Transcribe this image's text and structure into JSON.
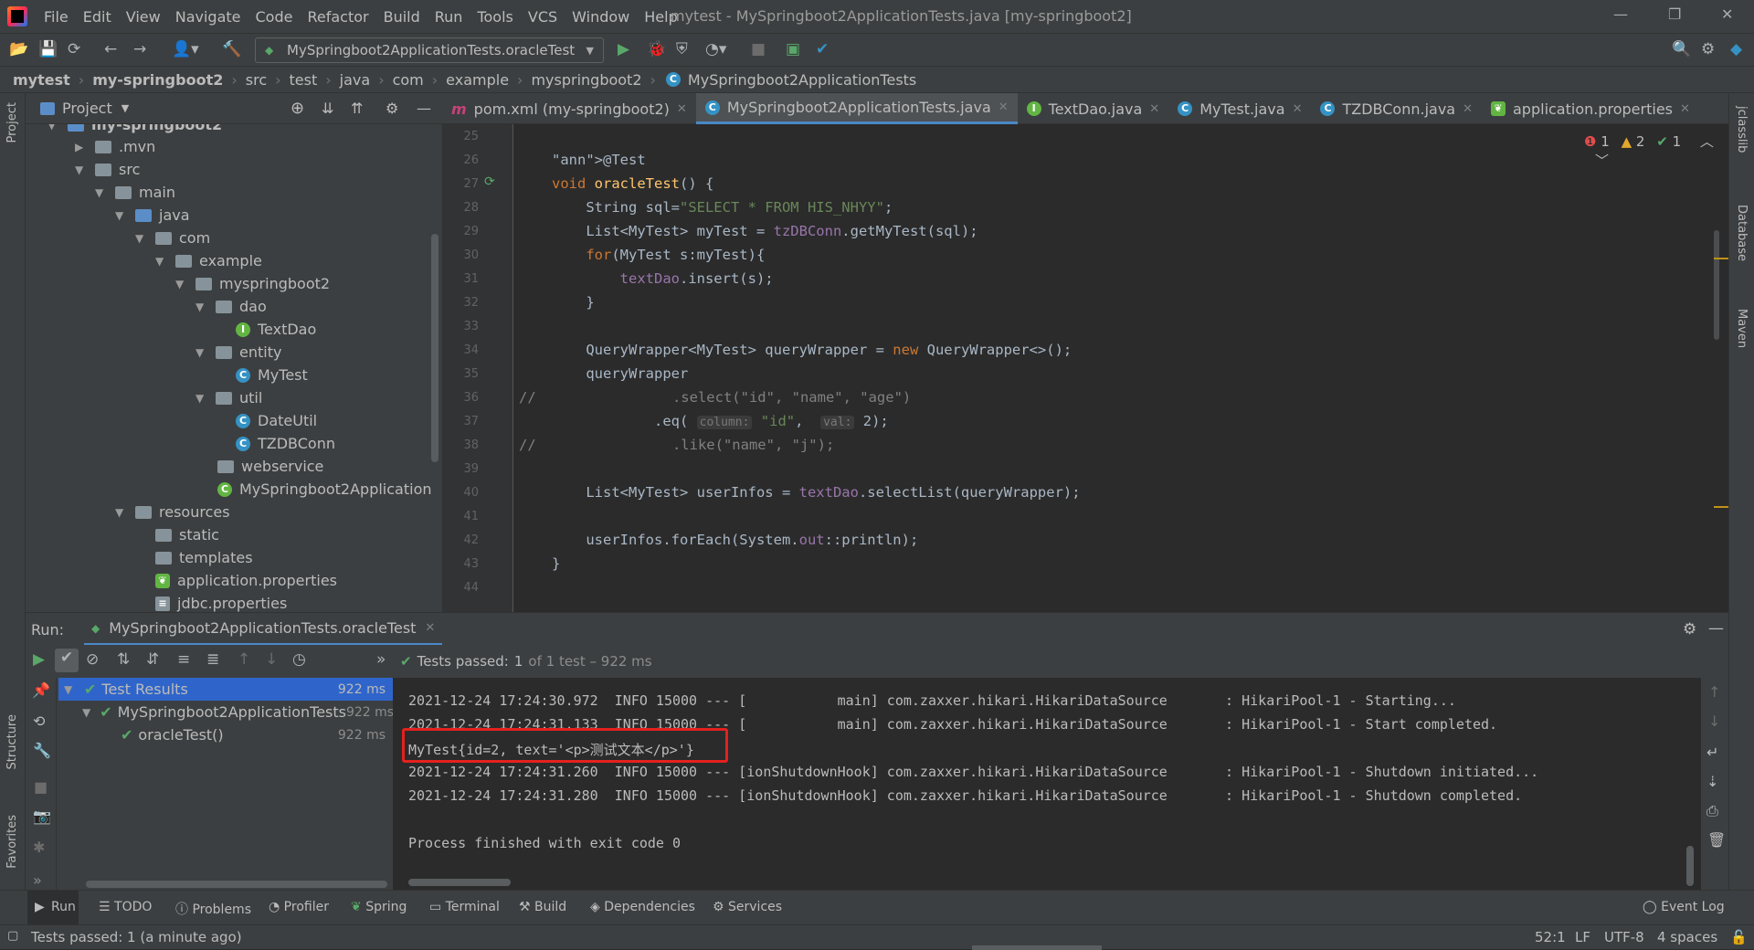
{
  "menubar": {
    "items": [
      "File",
      "Edit",
      "View",
      "Navigate",
      "Code",
      "Refactor",
      "Build",
      "Run",
      "Tools",
      "VCS",
      "Window",
      "Help"
    ],
    "window_title": "mytest - MySpringboot2ApplicationTests.java [my-springboot2]"
  },
  "toolbar": {
    "run_config": "MySpringboot2ApplicationTests.oracleTest"
  },
  "breadcrumb": [
    "mytest",
    "my-springboot2",
    "src",
    "test",
    "java",
    "com",
    "example",
    "myspringboot2",
    "MySpringboot2ApplicationTests"
  ],
  "project": {
    "title": "Project",
    "tree": [
      {
        "label": "my-springboot2",
        "kind": "module"
      },
      {
        "label": ".mvn",
        "kind": "folder"
      },
      {
        "label": "src",
        "kind": "folder"
      },
      {
        "label": "main",
        "kind": "folder"
      },
      {
        "label": "java",
        "kind": "src"
      },
      {
        "label": "com",
        "kind": "folder"
      },
      {
        "label": "example",
        "kind": "folder"
      },
      {
        "label": "myspringboot2",
        "kind": "folder"
      },
      {
        "label": "dao",
        "kind": "folder"
      },
      {
        "label": "TextDao",
        "kind": "interface"
      },
      {
        "label": "entity",
        "kind": "folder"
      },
      {
        "label": "MyTest",
        "kind": "class"
      },
      {
        "label": "util",
        "kind": "folder"
      },
      {
        "label": "DateUtil",
        "kind": "class"
      },
      {
        "label": "TZDBConn",
        "kind": "class"
      },
      {
        "label": "webservice",
        "kind": "folder"
      },
      {
        "label": "MySpringboot2Application",
        "kind": "springclass"
      },
      {
        "label": "resources",
        "kind": "res"
      },
      {
        "label": "static",
        "kind": "folder"
      },
      {
        "label": "templates",
        "kind": "folder"
      },
      {
        "label": "application.properties",
        "kind": "props"
      },
      {
        "label": "jdbc.properties",
        "kind": "props"
      }
    ]
  },
  "tabs": [
    {
      "label": "pom.xml (my-springboot2)",
      "icon": "m"
    },
    {
      "label": "MySpringboot2ApplicationTests.java",
      "icon": "C",
      "active": true
    },
    {
      "label": "TextDao.java",
      "icon": "I"
    },
    {
      "label": "MyTest.java",
      "icon": "C"
    },
    {
      "label": "TZDBConn.java",
      "icon": "C"
    },
    {
      "label": "application.properties",
      "icon": "leaf"
    }
  ],
  "inspections": {
    "errors": "1",
    "warnings": "2",
    "ok": "1"
  },
  "code": {
    "line_numbers": [
      "25",
      "26",
      "27",
      "28",
      "29",
      "30",
      "31",
      "32",
      "33",
      "34",
      "35",
      "36",
      "37",
      "38",
      "39",
      "40",
      "41",
      "42",
      "43",
      "44"
    ],
    "lines": [
      "",
      "    @Test",
      "    void oracleTest() {",
      "        String sql=\"SELECT * FROM HIS_NHYY\";",
      "        List<MyTest> myTest = tzDBConn.getMyTest(sql);",
      "        for(MyTest s:myTest){",
      "            textDao.insert(s);",
      "        }",
      "",
      "        QueryWrapper<MyTest> queryWrapper = new QueryWrapper<>();",
      "        queryWrapper",
      "//                .select(\"id\", \"name\", \"age\")",
      "                .eq( column: \"id\",  val: 2);",
      "//                .like(\"name\", \"j\");",
      "",
      "        List<MyTest> userInfos = textDao.selectList(queryWrapper);",
      "",
      "        userInfos.forEach(System.out::println);",
      "    }",
      ""
    ]
  },
  "run": {
    "label": "Run:",
    "config": "MySpringboot2ApplicationTests.oracleTest",
    "status_prefix": "Tests passed:",
    "status_count": "1",
    "status_suffix": "of 1 test – 922 ms",
    "results": [
      {
        "label": "Test Results",
        "time": "922 ms"
      },
      {
        "label": "MySpringboot2ApplicationTests",
        "time": "922 ms"
      },
      {
        "label": "oracleTest()",
        "time": "922 ms"
      }
    ],
    "console": [
      "2021-12-24 17:24:30.972  INFO 15000 --- [           main] com.zaxxer.hikari.HikariDataSource       : HikariPool-1 - Starting...",
      "2021-12-24 17:24:31.133  INFO 15000 --- [           main] com.zaxxer.hikari.HikariDataSource       : HikariPool-1 - Start completed.",
      "MyTest{id=2, text='<p>测试文本</p>'}",
      "2021-12-24 17:24:31.260  INFO 15000 --- [ionShutdownHook] com.zaxxer.hikari.HikariDataSource       : HikariPool-1 - Shutdown initiated...",
      "2021-12-24 17:24:31.280  INFO 15000 --- [ionShutdownHook] com.zaxxer.hikari.HikariDataSource       : HikariPool-1 - Shutdown completed.",
      "",
      "Process finished with exit code 0"
    ]
  },
  "bottom_tabs": [
    "Run",
    "TODO",
    "Problems",
    "Profiler",
    "Spring",
    "Terminal",
    "Build",
    "Dependencies",
    "Services"
  ],
  "event_log": "Event Log",
  "side": {
    "left": [
      "Project",
      "Structure",
      "Favorites"
    ],
    "right": [
      "jclasslib",
      "Database",
      "Maven"
    ]
  },
  "status": {
    "message": "Tests passed: 1 (a minute ago)",
    "position": "52:1",
    "line_sep": "LF",
    "encoding": "UTF-8",
    "indent": "4 spaces"
  }
}
